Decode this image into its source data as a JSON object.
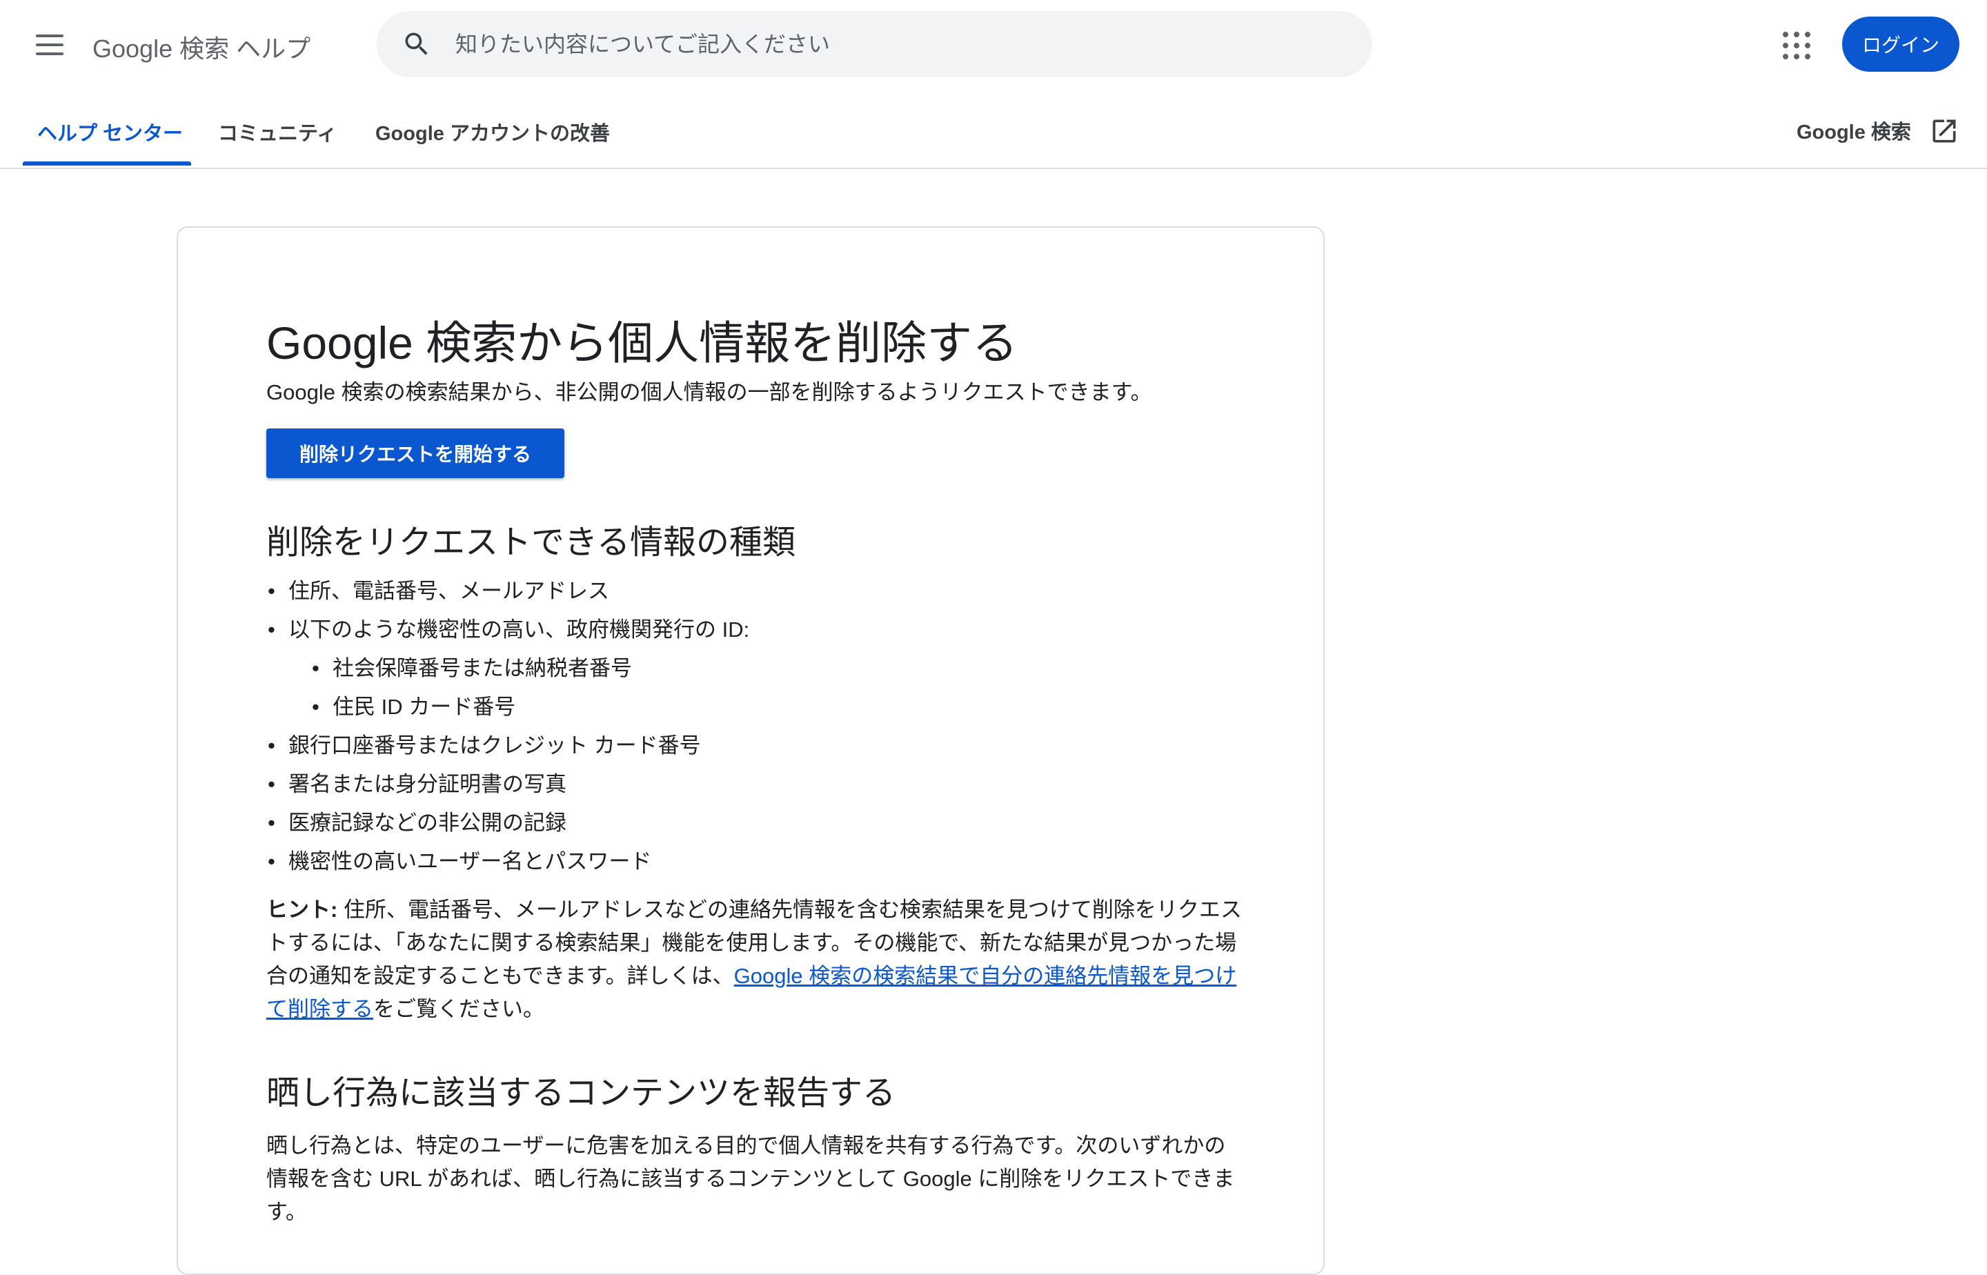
{
  "header": {
    "app_title": "Google 検索 ヘルプ",
    "search_placeholder": "知りたい内容についてご記入ください",
    "login_label": "ログイン"
  },
  "tabs": [
    {
      "label": "ヘルプ センター",
      "active": true
    },
    {
      "label": "コミュニティ",
      "active": false
    },
    {
      "label": "Google アカウントの改善",
      "active": false
    }
  ],
  "external_link": {
    "label": "Google 検索"
  },
  "article": {
    "title": "Google 検索から個人情報を削除する",
    "intro": "Google 検索の検索結果から、非公開の個人情報の一部を削除するようリクエストできます。",
    "start_button": "削除リクエストを開始する",
    "section1_heading": "削除をリクエストできる情報の種類",
    "list": {
      "item1": "住所、電話番号、メールアドレス",
      "item2": "以下のような機密性の高い、政府機関発行の ID:",
      "sub1": "社会保障番号または納税者番号",
      "sub2": "住民 ID カード番号",
      "item3": "銀行口座番号またはクレジット カード番号",
      "item4": "署名または身分証明書の写真",
      "item5": "医療記録などの非公開の記録",
      "item6": "機密性の高いユーザー名とパスワード"
    },
    "tip_label": "ヒント:",
    "tip_text": " 住所、電話番号、メールアドレスなどの連絡先情報を含む検索結果を見つけて削除をリクエストするには、「あなたに関する検索結果」機能を使用します。その機能で、新たな結果が見つかった場合の通知を設定することもできます。詳しくは、",
    "tip_link": "Google 検索の検索結果で自分の連絡先情報を見つけて削除する",
    "tip_suffix": "をご覧ください。",
    "section2_heading": "晒し行為に該当するコンテンツを報告する",
    "section2_text": "晒し行為とは、特定のユーザーに危害を加える目的で個人情報を共有する行為です。次のいずれかの情報を含む URL があれば、晒し行為に該当するコンテンツとして Google に削除をリクエストできます。"
  },
  "colors": {
    "accent": "#0b57d0",
    "text": "#202124",
    "muted": "#5f6368",
    "search_bg": "#f1f3f4",
    "divider": "#dadce0"
  }
}
